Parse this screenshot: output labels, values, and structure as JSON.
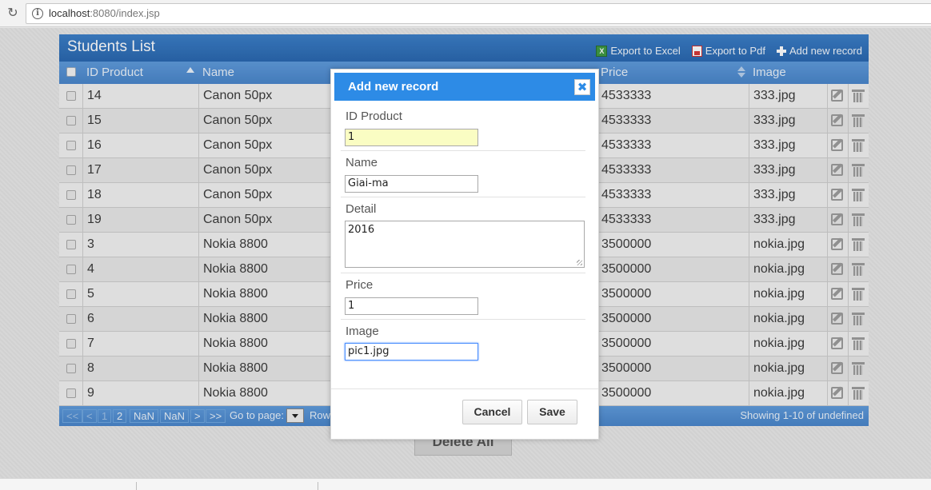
{
  "browser": {
    "url_host": "localhost",
    "url_path": ":8080/index.jsp"
  },
  "table": {
    "title": "Students List",
    "toolbar": {
      "export_excel": "Export to Excel",
      "export_pdf": "Export to Pdf",
      "add_record": "Add new record"
    },
    "columns": [
      "ID Product",
      "Name",
      "Price",
      "Image"
    ],
    "rows": [
      {
        "id": "14",
        "name": "Canon 50px",
        "price": "4533333",
        "image": "333.jpg"
      },
      {
        "id": "15",
        "name": "Canon 50px",
        "price": "4533333",
        "image": "333.jpg"
      },
      {
        "id": "16",
        "name": "Canon 50px",
        "price": "4533333",
        "image": "333.jpg"
      },
      {
        "id": "17",
        "name": "Canon 50px",
        "price": "4533333",
        "image": "333.jpg"
      },
      {
        "id": "18",
        "name": "Canon 50px",
        "price": "4533333",
        "image": "333.jpg"
      },
      {
        "id": "19",
        "name": "Canon 50px",
        "price": "4533333",
        "image": "333.jpg"
      },
      {
        "id": "3",
        "name": "Nokia 8800",
        "price": "3500000",
        "image": "nokia.jpg"
      },
      {
        "id": "4",
        "name": "Nokia 8800",
        "price": "3500000",
        "image": "nokia.jpg"
      },
      {
        "id": "5",
        "name": "Nokia 8800",
        "price": "3500000",
        "image": "nokia.jpg"
      },
      {
        "id": "6",
        "name": "Nokia 8800",
        "price": "3500000",
        "image": "nokia.jpg"
      },
      {
        "id": "7",
        "name": "Nokia 8800",
        "price": "3500000",
        "image": "nokia.jpg"
      },
      {
        "id": "8",
        "name": "Nokia 8800",
        "price": "3500000",
        "image": "nokia.jpg"
      },
      {
        "id": "9",
        "name": "Nokia 8800",
        "price": "3500000",
        "image": "nokia.jpg"
      }
    ],
    "pager": {
      "first": "<<",
      "prev": "<",
      "page1": "1",
      "page2": "2",
      "nan1": "NaN",
      "nan2": "NaN",
      "next": ">",
      "last": ">>",
      "goto_label": "Go to page:",
      "rows_label": "Row",
      "info": "Showing 1-10 of undefined"
    },
    "delete_all": "Delete All"
  },
  "dialog": {
    "title": "Add new record",
    "close_glyph": "✖",
    "fields": {
      "id_label": "ID Product",
      "id_value": "1",
      "name_label": "Name",
      "name_value": "Giai-ma",
      "detail_label": "Detail",
      "detail_value": "2016",
      "price_label": "Price",
      "price_value": "1",
      "image_label": "Image",
      "image_value": "pic1.jpg"
    },
    "cancel": "Cancel",
    "save": "Save"
  },
  "colors": {
    "title_bar": "#2d6db5",
    "header": "#4a86cb",
    "dialog_title": "#2d8be6"
  }
}
